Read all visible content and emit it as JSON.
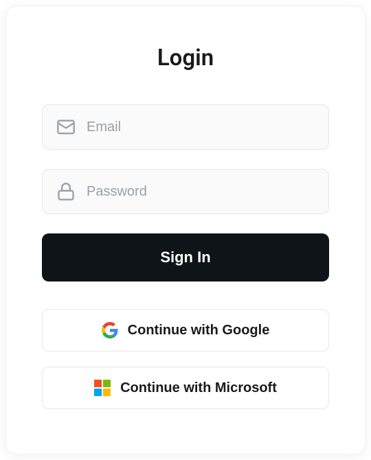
{
  "title": "Login",
  "email": {
    "placeholder": "Email",
    "value": ""
  },
  "password": {
    "placeholder": "Password",
    "value": ""
  },
  "signin_label": "Sign In",
  "google_label": "Continue with Google",
  "microsoft_label": "Continue with Microsoft"
}
